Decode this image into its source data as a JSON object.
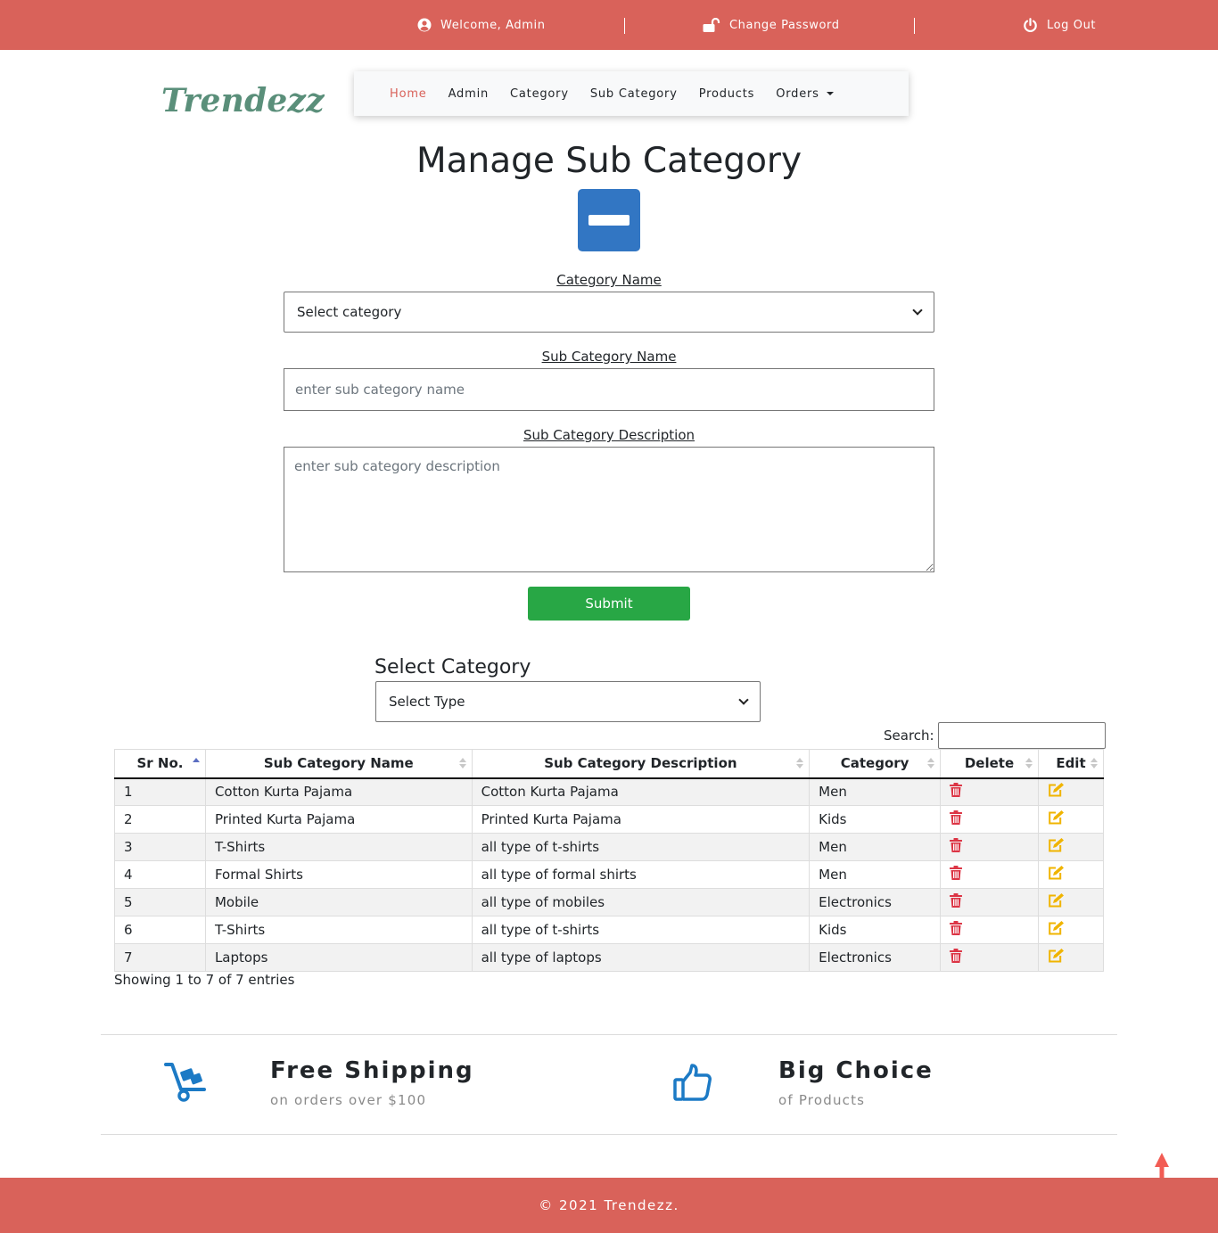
{
  "topbar": {
    "welcome": "Welcome, Admin",
    "change_password": "Change Password",
    "logout": "Log Out"
  },
  "brand": "Trendezz",
  "nav": {
    "items": [
      "Home",
      "Admin",
      "Category",
      "Sub Category",
      "Products",
      "Orders"
    ],
    "active": "Home"
  },
  "page": {
    "title": "Manage Sub Category"
  },
  "form": {
    "category_label": "Category Name",
    "category_selected": "Select category",
    "subcat_label": "Sub Category Name",
    "subcat_placeholder": "enter sub category name",
    "desc_label": "Sub Category Description",
    "desc_placeholder": "enter sub category description",
    "submit": "Submit"
  },
  "filter": {
    "label": "Select Category",
    "selected": "Select Type",
    "search_label": "Search:"
  },
  "table": {
    "columns": [
      "Sr No.",
      "Sub Category Name",
      "Sub Category Description",
      "Category",
      "Delete",
      "Edit"
    ],
    "rows": [
      {
        "sr": "1",
        "name": "Cotton Kurta Pajama",
        "desc": "Cotton Kurta Pajama",
        "category": "Men"
      },
      {
        "sr": "2",
        "name": "Printed Kurta Pajama",
        "desc": "Printed Kurta Pajama",
        "category": "Kids"
      },
      {
        "sr": "3",
        "name": "T-Shirts",
        "desc": "all type of t-shirts",
        "category": "Men"
      },
      {
        "sr": "4",
        "name": "Formal Shirts",
        "desc": "all type of formal shirts",
        "category": "Men"
      },
      {
        "sr": "5",
        "name": "Mobile",
        "desc": "all type of mobiles",
        "category": "Electronics"
      },
      {
        "sr": "6",
        "name": "T-Shirts",
        "desc": "all type of t-shirts",
        "category": "Kids"
      },
      {
        "sr": "7",
        "name": "Laptops",
        "desc": "all type of laptops",
        "category": "Electronics"
      }
    ],
    "info": "Showing 1 to 7 of 7 entries"
  },
  "features": [
    {
      "icon": "cart-dolly-icon",
      "title": "Free Shipping",
      "subtitle": "on orders over $100"
    },
    {
      "icon": "thumbs-up-icon",
      "title": "Big Choice",
      "subtitle": "of Products"
    }
  ],
  "footer": {
    "copyright": "© 2021 Trendezz."
  },
  "colors": {
    "brand_red": "#d9625a",
    "brand_green": "#5a8f7a",
    "primary_blue": "#3276c3",
    "submit_green": "#28a745",
    "delete_red": "#dc3545",
    "edit_yellow": "#f0b400",
    "feature_blue": "#1c7ac5"
  }
}
